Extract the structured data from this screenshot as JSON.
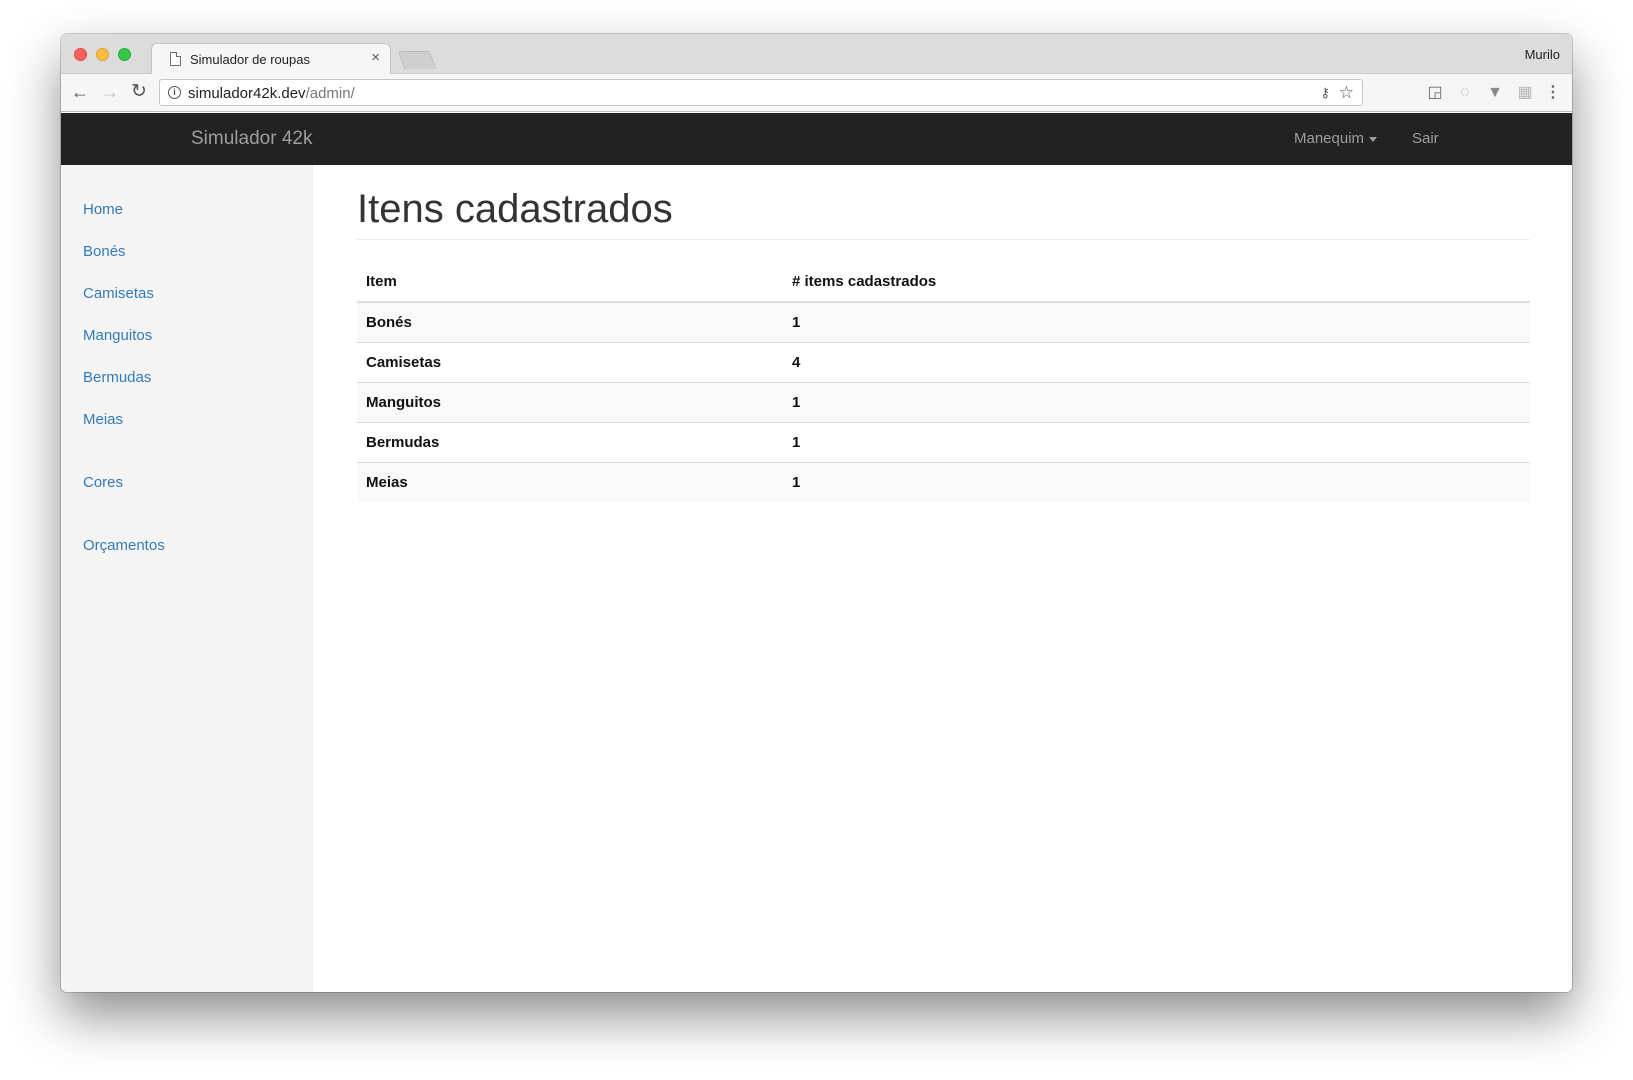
{
  "browser": {
    "tab_title": "Simulador de roupas",
    "tab_close": "×",
    "profile_name": "Murilo",
    "url_host": "simulador42k.dev",
    "url_path": "/admin/",
    "icons": {
      "back": "left-arrow",
      "forward": "right-arrow",
      "reload": "reload",
      "info": "info-circle",
      "key": "key",
      "star": "star",
      "cast": "cast",
      "menu": "vertical-ellipsis"
    }
  },
  "navbar": {
    "brand": "Simulador 42k",
    "dropdown_label": "Manequim",
    "logout_label": "Sair",
    "background": "#222222",
    "text_color": "#9d9d9d"
  },
  "sidebar": {
    "items": [
      {
        "label": "Home"
      },
      {
        "label": "Bonés"
      },
      {
        "label": "Camisetas"
      },
      {
        "label": "Manguitos"
      },
      {
        "label": "Bermudas"
      },
      {
        "label": "Meias"
      },
      {
        "label": "Cores"
      },
      {
        "label": "Orçamentos"
      }
    ],
    "link_color": "#337ab7"
  },
  "main": {
    "title": "Itens cadastrados",
    "table": {
      "headers": [
        "Item",
        "# items cadastrados"
      ],
      "rows": [
        {
          "item": "Bonés",
          "count": "1"
        },
        {
          "item": "Camisetas",
          "count": "4"
        },
        {
          "item": "Manguitos",
          "count": "1"
        },
        {
          "item": "Bermudas",
          "count": "1"
        },
        {
          "item": "Meias",
          "count": "1"
        }
      ]
    }
  }
}
